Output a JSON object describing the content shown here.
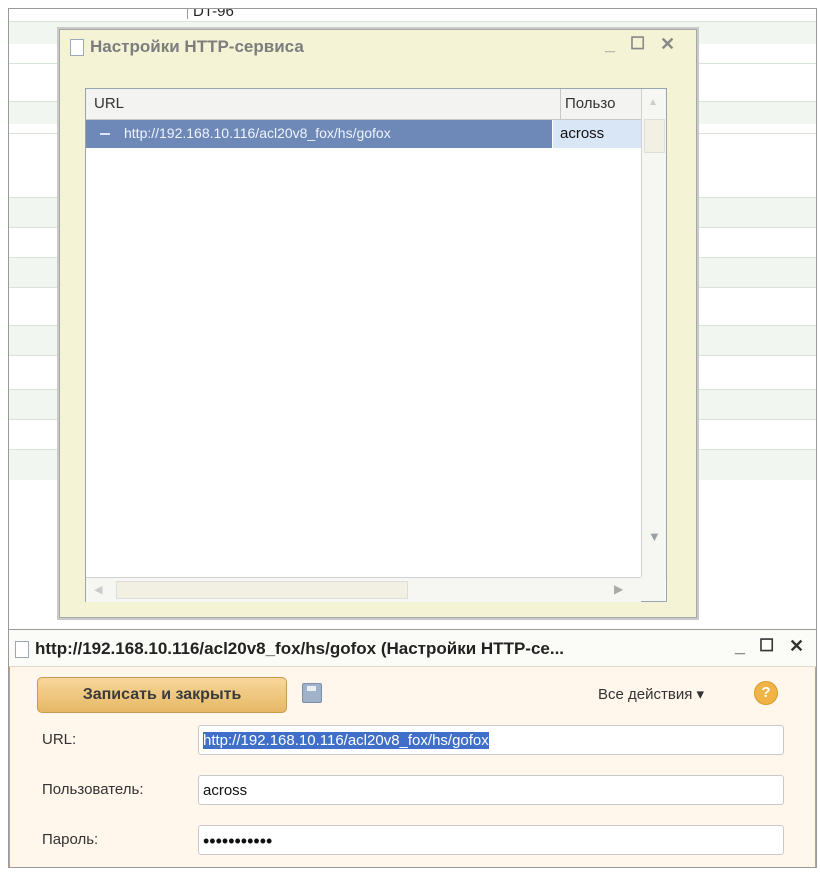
{
  "background_list": {
    "row_code": "DT-96"
  },
  "http_settings_window": {
    "title": "Настройки HTTP-сервиса",
    "columns": {
      "url": "URL",
      "user": "Пользо"
    },
    "rows": [
      {
        "url": "http://192.168.10.116/acl20v8_fox/hs/gofox",
        "user": "across"
      }
    ]
  },
  "record_window": {
    "title": "http://192.168.10.116/acl20v8_fox/hs/gofox (Настройки HTTP-се...",
    "save_close_label": "Записать и закрыть",
    "all_actions_label": "Все действия ▾",
    "help_label": "?",
    "fields": {
      "url_label": "URL:",
      "url_value": "http://192.168.10.116/acl20v8_fox/hs/gofox",
      "user_label": "Пользователь:",
      "user_value": "across",
      "password_label": "Пароль:",
      "password_value": "•••••••••••"
    }
  },
  "icons": {
    "minimize": "minimize-icon",
    "maximize": "maximize-icon",
    "close": "close-icon",
    "save": "floppy-icon",
    "help": "help-icon"
  },
  "colors": {
    "selected_row": "#6e89b8",
    "button_gold": "#e6b866",
    "selection_blue": "#3f6fc8"
  }
}
